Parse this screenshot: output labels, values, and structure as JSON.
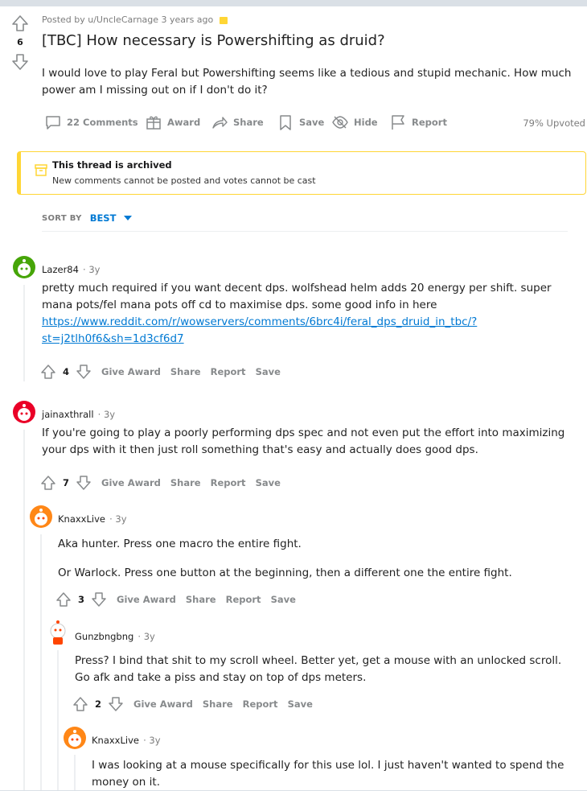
{
  "post": {
    "score": "6",
    "meta": "Posted by u/UncleCarnage 3 years ago",
    "title": "[TBC] How necessary is Powershifting as druid?",
    "body": "I would love to play Feral but Powershifting seems like a tedious and stupid mechanic. How much power am I missing out on if I don't do it?",
    "actions": {
      "comments": "22 Comments",
      "award": "Award",
      "share": "Share",
      "save": "Save",
      "hide": "Hide",
      "report": "Report",
      "upvoted": "79% Upvoted"
    }
  },
  "archived": {
    "title": "This thread is archived",
    "subtitle": "New comments cannot be posted and votes cannot be cast"
  },
  "sort": {
    "label": "SORT BY",
    "value": "BEST"
  },
  "comments": [
    {
      "author": "Lazer84",
      "age": "3y",
      "text_before": "pretty much required if you want decent dps. wolfshead helm adds 20 energy per shift. super mana pots/fel mana pots off cd to maximise dps. some good info in here",
      "link_line1": "https://www.reddit.com/r/wowservers/comments/6brc4i/feral_dps_druid_in_tbc/?",
      "link_line2": "st=j2tlh0f6&sh=1d3cf6d7",
      "score": "4",
      "give_award": "Give Award",
      "share": "Share",
      "report": "Report",
      "save": "Save"
    },
    {
      "author": "jainaxthrall",
      "age": "3y",
      "text": "If you're going to play a poorly performing dps spec and not even put the effort into maximizing your dps with it then just roll something that's easy and actually does good dps.",
      "score": "7",
      "give_award": "Give Award",
      "share": "Share",
      "report": "Report",
      "save": "Save"
    },
    {
      "author": "KnaxxLive",
      "age": "3y",
      "text_p1": "Aka hunter. Press one macro the entire fight.",
      "text_p2": "Or Warlock. Press one button at the beginning, then a different one the entire fight.",
      "score": "3",
      "give_award": "Give Award",
      "share": "Share",
      "report": "Report",
      "save": "Save"
    },
    {
      "author": "Gunzbngbng",
      "age": "3y",
      "text": "Press? I bind that shit to my scroll wheel. Better yet, get a mouse with an unlocked scroll. Go afk and take a piss and stay on top of dps meters.",
      "score": "2",
      "give_award": "Give Award",
      "share": "Share",
      "report": "Report",
      "save": "Save"
    },
    {
      "author": "KnaxxLive",
      "age": "3y",
      "text": "I was looking at a mouse specifically for this use lol. I just haven't wanted to spend the money on it."
    }
  ],
  "colors": {
    "accent": "#0079d3",
    "archived_border": "#ffd635",
    "meta": "#7c7c7c"
  }
}
